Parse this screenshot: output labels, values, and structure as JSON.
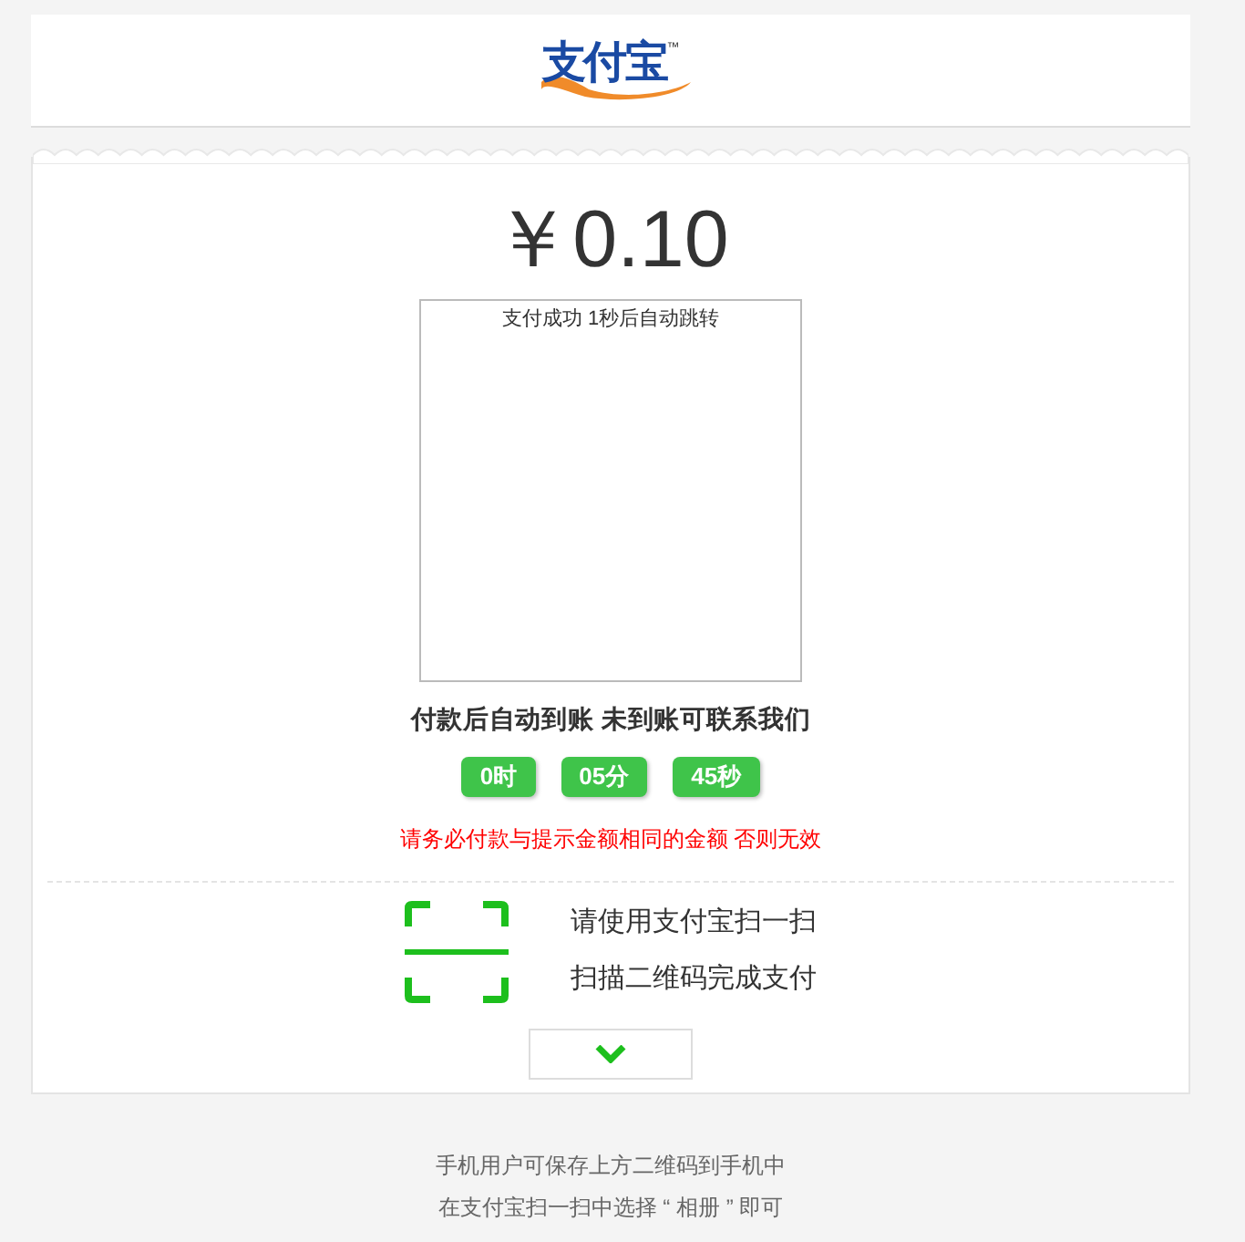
{
  "header": {
    "logo_text": "支付宝",
    "logo_mark": "™"
  },
  "payment": {
    "amount": "￥0.10",
    "qr_status": "支付成功 1秒后自动跳转",
    "notice": "付款后自动到账 未到账可联系我们",
    "countdown": [
      "0时",
      "05分",
      "45秒"
    ],
    "warning": "请务必付款与提示金额相同的金额 否则无效",
    "instructions": [
      "请使用支付宝扫一扫",
      "扫描二维码完成支付"
    ]
  },
  "footer": [
    "手机用户可保存上方二维码到手机中",
    "在支付宝扫一扫中选择 “ 相册 ” 即可"
  ]
}
